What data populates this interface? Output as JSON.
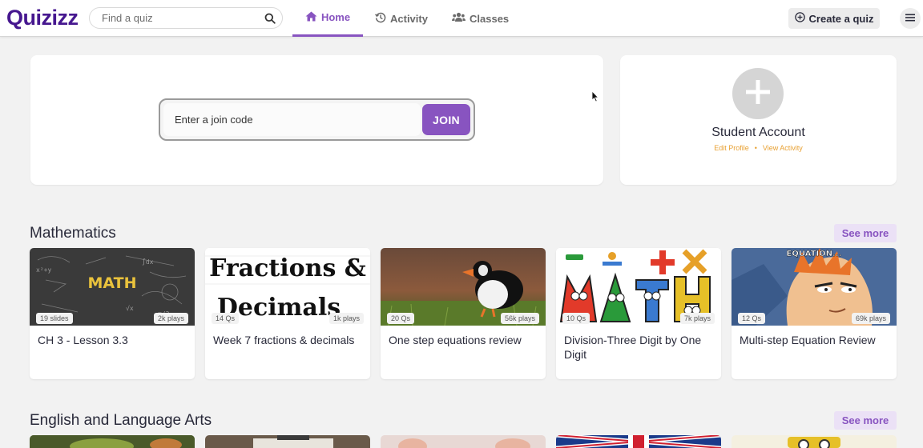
{
  "header": {
    "logo": "Quizizz",
    "search_placeholder": "Find a quiz",
    "tabs": [
      {
        "label": "Home",
        "icon": "home-icon"
      },
      {
        "label": "Activity",
        "icon": "history-icon"
      },
      {
        "label": "Classes",
        "icon": "users-icon"
      }
    ],
    "create_label": "Create a quiz"
  },
  "join": {
    "placeholder": "Enter a join code",
    "button": "JOIN"
  },
  "account": {
    "name": "Student Account",
    "edit_profile": "Edit Profile",
    "separator": "•",
    "view_activity": "View Activity"
  },
  "sections": [
    {
      "title": "Mathematics",
      "see_more": "See more",
      "cards": [
        {
          "count": "19 slides",
          "plays": "2k plays",
          "title": "CH 3 - Lesson 3.3",
          "thumb_text": "MATH"
        },
        {
          "count": "14 Qs",
          "plays": "1k plays",
          "title": "Week 7 fractions & decimals",
          "thumb_line1": "Fractions &",
          "thumb_line2": "Decimals"
        },
        {
          "count": "20 Qs",
          "plays": "56k plays",
          "title": "One step equations review"
        },
        {
          "count": "10 Qs",
          "plays": "7k plays",
          "title": "Division-Three Digit by One Digit"
        },
        {
          "count": "12 Qs",
          "plays": "69k plays",
          "title": "Multi-step Equation Review",
          "thumb_text": "EQUATION..."
        }
      ]
    },
    {
      "title": "English and Language Arts",
      "see_more": "See more"
    }
  ],
  "colors": {
    "brand": "#46178f",
    "accent": "#8854c0",
    "link": "#e8a133",
    "background": "#f2f2f2"
  }
}
